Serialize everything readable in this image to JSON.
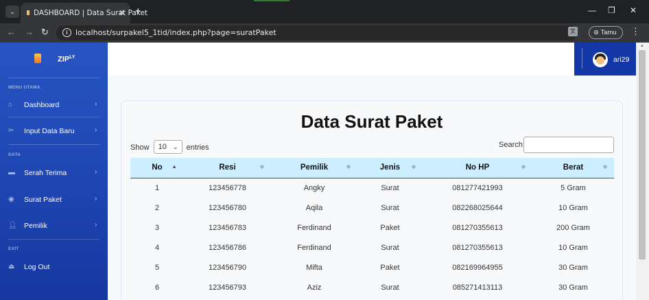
{
  "browser": {
    "tab_title": "DASHBOARD | Data Surat Paket",
    "url": "localhost/surpakel5_1tid/index.php?page=suratPaket",
    "profile_label": "Tamu"
  },
  "sidebar": {
    "brand": "ZIP",
    "brand_sup": "LY",
    "sections": [
      "MENU UTAMA",
      "DATA",
      "EXIT"
    ],
    "items": [
      {
        "label": "Dashboard",
        "icon": "home-icon"
      },
      {
        "label": "Input Data Baru",
        "icon": "tools-icon"
      },
      {
        "label": "Serah Terima",
        "icon": "tray-icon"
      },
      {
        "label": "Surat Paket",
        "icon": "disc-icon"
      },
      {
        "label": "Pemilik",
        "icon": "user-icon"
      },
      {
        "label": "Log Out",
        "icon": "logout-icon"
      }
    ]
  },
  "topbar": {
    "username": "ari29"
  },
  "main": {
    "title": "Data Surat Paket",
    "show_label": "Show",
    "entries_value": "10",
    "entries_label": "entries",
    "search_label": "Search:"
  },
  "table": {
    "columns": [
      "No",
      "Resi",
      "Pemilik",
      "Jenis",
      "No HP",
      "Berat"
    ],
    "rows": [
      [
        "1",
        "123456778",
        "Angky",
        "Surat",
        "081277421993",
        "5 Gram"
      ],
      [
        "2",
        "123456780",
        "Aqila",
        "Surat",
        "082268025644",
        "10 Gram"
      ],
      [
        "3",
        "123456783",
        "Ferdinand",
        "Paket",
        "081270355613",
        "200 Gram"
      ],
      [
        "4",
        "123456786",
        "Ferdinand",
        "Surat",
        "081270355613",
        "10 Gram"
      ],
      [
        "5",
        "123456790",
        "Mifta",
        "Paket",
        "082169964955",
        "30 Gram"
      ],
      [
        "6",
        "123456793",
        "Aziz",
        "Surat",
        "085271413113",
        "30 Gram"
      ]
    ]
  }
}
